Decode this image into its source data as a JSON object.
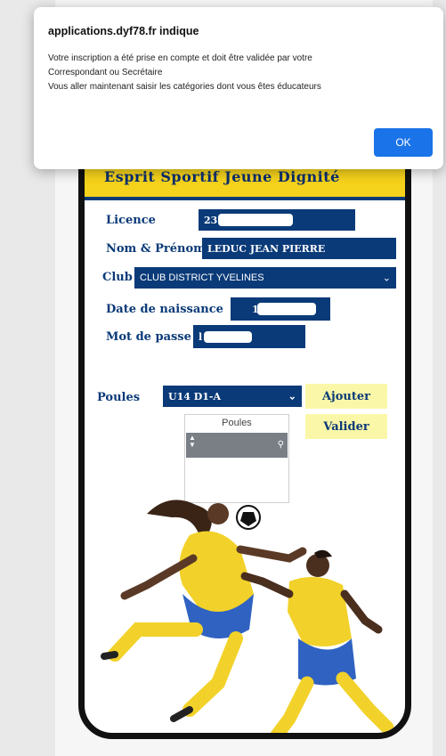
{
  "dialog": {
    "title": "applications.dyf78.fr indique",
    "message_lines": [
      "Votre inscription a été prise en compte et doit être validée par votre",
      "Correspondant ou Secrétaire",
      "Vous aller maintenant saisir les catégories dont vous êtes éducateurs"
    ],
    "ok_label": "OK"
  },
  "banner": {
    "title": "Esprit Sportif Jeune Dignité"
  },
  "form": {
    "licence_label": "Licence",
    "licence_value": "23",
    "name_label": "Nom & Prénom",
    "name_value": "LEDUC JEAN PIERRE",
    "club_label": "Club",
    "club_value": "CLUB DISTRICT YVELINES",
    "birthdate_label": "Date de naissance",
    "birthdate_value": "1",
    "password_label": "Mot de passe",
    "password_value": "l",
    "poules_label": "Poules",
    "poules_value": "U14 D1-A",
    "add_label": "Ajouter",
    "validate_label": "Valider",
    "list_header": "Poules"
  },
  "colors": {
    "navy": "#0a3a78",
    "yellow": "#f5d21b",
    "button_yellow": "#fbf7a8",
    "ok_blue": "#1a73e8"
  }
}
